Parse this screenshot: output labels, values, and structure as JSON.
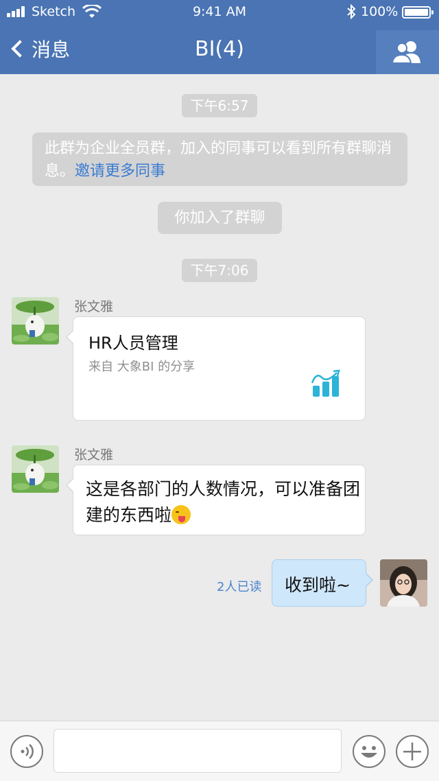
{
  "status_bar": {
    "carrier": "Sketch",
    "time": "9:41 AM",
    "battery": "100%",
    "bluetooth_glyph": "✱"
  },
  "nav": {
    "back_label": "消息",
    "title": "BI(4)",
    "people_icon": "group-members-icon"
  },
  "messages": {
    "timestamp_1": "下午6:57",
    "system_note_text": "此群为企业全员群，加入的同事可以看到所有群聊消息。",
    "system_note_link": "邀请更多同事",
    "joined_notice": "你加入了群聊",
    "timestamp_2": "下午7:06",
    "share_message": {
      "sender": "张文雅",
      "title": "HR人员管理",
      "source": "来自 大象BI 的分享",
      "icon": "bar-chart-trend-icon"
    },
    "text_message": {
      "sender": "张文雅",
      "text": "这是各部门的人数情况，可以准备团建的东西啦",
      "emoji": "winking-tongue-emoji"
    },
    "own_message": {
      "text": "收到啦~",
      "read_receipt": "2人已读"
    }
  },
  "input_bar": {
    "voice_icon": "voice-icon",
    "emoji_icon": "emoji-icon",
    "plus_icon": "plus-icon",
    "placeholder": ""
  },
  "colors": {
    "nav_bar": "#4a74b3",
    "link": "#3b7bd3",
    "own_bubble": "#cfe7fb",
    "chart_icon": "#2bb3d8"
  }
}
